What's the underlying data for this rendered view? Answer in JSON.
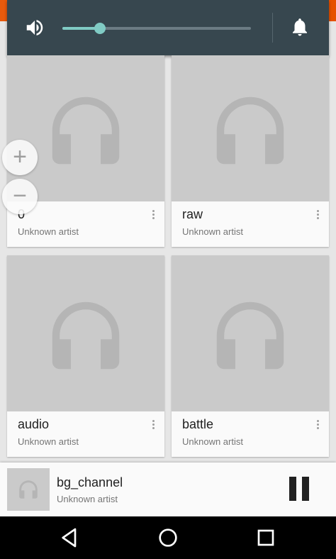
{
  "colors": {
    "status_bar": "#e65100",
    "volume_panel": "#37474f",
    "slider_accent": "#80cbc4",
    "album_art_bg": "#cacaca",
    "card_bg": "#fafafa",
    "title_text": "#212121",
    "subtitle_text": "#757575"
  },
  "volume": {
    "speaker_icon": "volume-up-icon",
    "level": 0.2,
    "notification_icon": "bell-icon"
  },
  "zoom": {
    "in_label": "+",
    "out_label": "−"
  },
  "albums": [
    {
      "title": "0",
      "artist": "Unknown artist",
      "art_icon": "headphones-icon"
    },
    {
      "title": "raw",
      "artist": "Unknown artist",
      "art_icon": "headphones-icon"
    },
    {
      "title": "audio",
      "artist": "Unknown artist",
      "art_icon": "headphones-icon"
    },
    {
      "title": "battle",
      "artist": "Unknown artist",
      "art_icon": "headphones-icon"
    }
  ],
  "now_playing": {
    "title": "bg_channel",
    "artist": "Unknown artist",
    "control_icon": "pause-icon"
  },
  "navigation": {
    "back_icon": "back-triangle-icon",
    "home_icon": "home-circle-icon",
    "recents_icon": "recents-square-icon"
  }
}
